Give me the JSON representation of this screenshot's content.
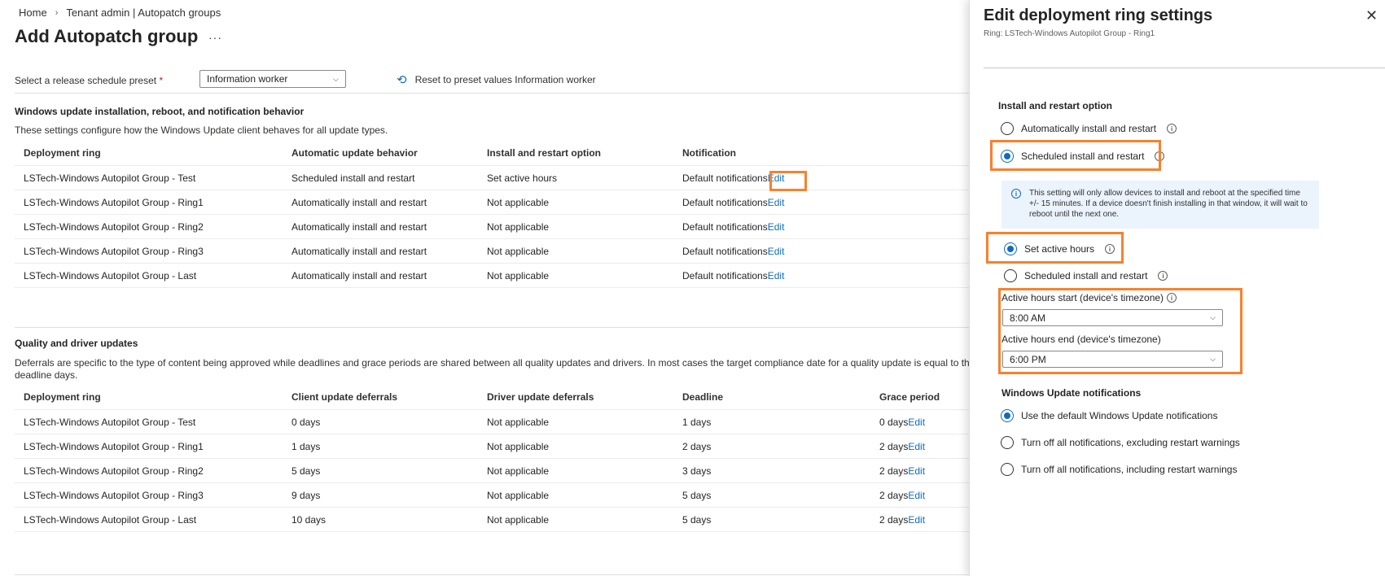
{
  "breadcrumb": {
    "home": "Home",
    "current": "Tenant admin | Autopatch groups"
  },
  "page": {
    "title": "Add Autopatch group",
    "more": "···"
  },
  "preset": {
    "label": "Select a release schedule preset",
    "required_mark": "*",
    "value": "Information worker",
    "reset_label": "Reset to preset values Information worker"
  },
  "wu_section": {
    "title": "Windows update installation, reboot, and notification behavior",
    "desc": "These settings configure how the Windows Update client behaves for all update types.",
    "headers": [
      "Deployment ring",
      "Automatic update behavior",
      "Install and restart option",
      "Notification"
    ],
    "rows": [
      {
        "ring": "LSTech-Windows Autopilot Group - Test",
        "behavior": "Scheduled install and restart",
        "option": "Set active hours",
        "notification": "Default notifications",
        "edit": "Edit"
      },
      {
        "ring": "LSTech-Windows Autopilot Group - Ring1",
        "behavior": "Automatically install and restart",
        "option": "Not applicable",
        "notification": "Default notifications",
        "edit": "Edit"
      },
      {
        "ring": "LSTech-Windows Autopilot Group - Ring2",
        "behavior": "Automatically install and restart",
        "option": "Not applicable",
        "notification": "Default notifications",
        "edit": "Edit"
      },
      {
        "ring": "LSTech-Windows Autopilot Group - Ring3",
        "behavior": "Automatically install and restart",
        "option": "Not applicable",
        "notification": "Default notifications",
        "edit": "Edit"
      },
      {
        "ring": "LSTech-Windows Autopilot Group - Last",
        "behavior": "Automatically install and restart",
        "option": "Not applicable",
        "notification": "Default notifications",
        "edit": "Edit"
      }
    ]
  },
  "quality_section": {
    "title": "Quality and driver updates",
    "desc_line1": "Deferrals are specific to the type of content being approved while deadlines and grace periods are shared between all quality updates and drivers. In most cases the target compliance date for a quality update is equal to the rel",
    "desc_line2": "deadline days.",
    "headers": [
      "Deployment ring",
      "Client update deferrals",
      "Driver update deferrals",
      "Deadline",
      "Grace period"
    ],
    "rows": [
      {
        "ring": "LSTech-Windows Autopilot Group - Test",
        "client": "0 days",
        "driver": "Not applicable",
        "deadline": "1 days",
        "grace": "0 days",
        "edit": "Edit"
      },
      {
        "ring": "LSTech-Windows Autopilot Group - Ring1",
        "client": "1 days",
        "driver": "Not applicable",
        "deadline": "2 days",
        "grace": "2 days",
        "edit": "Edit"
      },
      {
        "ring": "LSTech-Windows Autopilot Group - Ring2",
        "client": "5 days",
        "driver": "Not applicable",
        "deadline": "3 days",
        "grace": "2 days",
        "edit": "Edit"
      },
      {
        "ring": "LSTech-Windows Autopilot Group - Ring3",
        "client": "9 days",
        "driver": "Not applicable",
        "deadline": "5 days",
        "grace": "2 days",
        "edit": "Edit"
      },
      {
        "ring": "LSTech-Windows Autopilot Group - Last",
        "client": "10 days",
        "driver": "Not applicable",
        "deadline": "5 days",
        "grace": "2 days",
        "edit": "Edit"
      }
    ]
  },
  "panel": {
    "title": "Edit deployment ring settings",
    "subtitle": "Ring: LSTech-Windows Autopilot Group - Ring1",
    "close": "✕",
    "install_title": "Install and restart option",
    "opt_auto": "Automatically install and restart",
    "opt_scheduled": "Scheduled install and restart",
    "info_text": "This setting will only allow devices to install and reboot at the specified time +/- 15 minutes. If a device doesn't finish installing in that window, it will wait to reboot until the next one.",
    "sub_active": "Set active hours",
    "sub_scheduled": "Scheduled install and restart",
    "start_label": "Active hours start (device's timezone)",
    "start_value": "8:00 AM",
    "end_label": "Active hours end (device's timezone)",
    "end_value": "6:00 PM",
    "notif_title": "Windows Update notifications",
    "notif_default": "Use the default Windows Update notifications",
    "notif_off_excl": "Turn off all notifications, excluding restart warnings",
    "notif_off_incl": "Turn off all notifications, including restart warnings"
  },
  "colors": {
    "accent": "#0f6cbd",
    "highlight": "#f7812e"
  }
}
